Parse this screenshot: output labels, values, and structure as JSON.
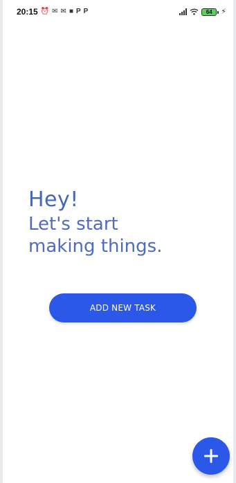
{
  "status_bar": {
    "time": "20:15",
    "notification_icons": [
      "alarm-icon",
      "mail-icon",
      "mail-icon",
      "video-icon",
      "p-app-icon",
      "p-app-icon"
    ],
    "battery_level": "64",
    "charging": true
  },
  "greeting": {
    "title": "Hey!",
    "line1": "Let's start",
    "line2": "making things."
  },
  "add_task_button": {
    "label": "ADD NEW TASK"
  },
  "fab": {
    "icon": "plus-icon",
    "label": "+"
  },
  "colors": {
    "primary": "#2b58e8",
    "text_accent": "#4567b7",
    "background": "#ffffff"
  }
}
